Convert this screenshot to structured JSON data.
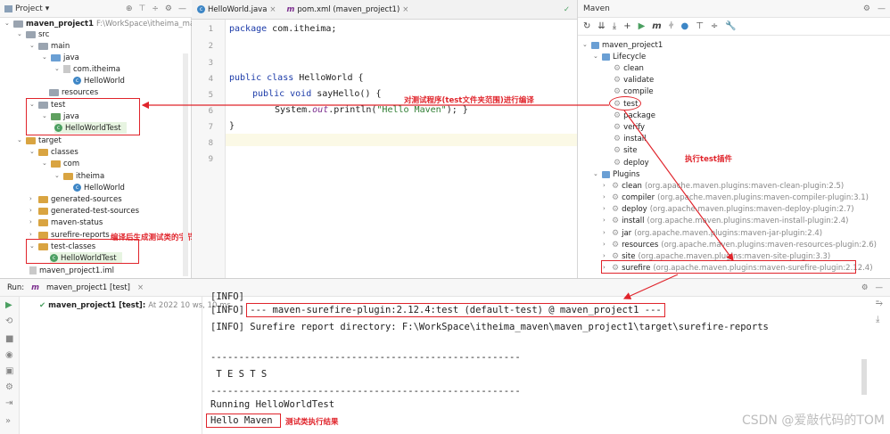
{
  "project": {
    "header_label": "Project",
    "root": {
      "name": "maven_project1",
      "path": "F:\\WorkSpace\\itheima_mave"
    },
    "items": {
      "src": "src",
      "main": "main",
      "java": "java",
      "com_itheima": "com.itheima",
      "helloworld": "HelloWorld",
      "resources": "resources",
      "test": "test",
      "test_java": "java",
      "helloworldtest": "HelloWorldTest",
      "target": "target",
      "classes": "classes",
      "com": "com",
      "itheima": "itheima",
      "helloworld_class": "HelloWorld",
      "generated_sources": "generated-sources",
      "generated_test_sources": "generated-test-sources",
      "maven_status": "maven-status",
      "surefire_reports": "surefire-reports",
      "test_classes": "test-classes",
      "helloworldtest_class": "HelloWorldTest",
      "iml": "maven_project1.iml"
    }
  },
  "editor": {
    "tabs": [
      {
        "label": "HelloWorld.java"
      },
      {
        "label": "pom.xml (maven_project1)"
      }
    ],
    "lines": [
      "1",
      "2",
      "3",
      "4",
      "5",
      "6",
      "7",
      "8",
      "9"
    ],
    "code": {
      "l1_kw": "package",
      "l1_rest": " com.itheima;",
      "l4_kw": "public class",
      "l4_rest": " HelloWorld {",
      "l5_kw": "public void",
      "l5_rest": " sayHello() {",
      "l6_pre": "System.",
      "l6_it": "out",
      "l6_mid": ".println(",
      "l6_str": "\"Hello Maven\"",
      "l6_end": "); }",
      "l7": "}"
    }
  },
  "maven": {
    "title": "Maven",
    "project": "maven_project1",
    "lifecycle_label": "Lifecycle",
    "lifecycle": [
      "clean",
      "validate",
      "compile",
      "test",
      "package",
      "verify",
      "install",
      "site",
      "deploy"
    ],
    "plugins_label": "Plugins",
    "plugins": [
      {
        "name": "clean",
        "detail": "(org.apache.maven.plugins:maven-clean-plugin:2.5)"
      },
      {
        "name": "compiler",
        "detail": "(org.apache.maven.plugins:maven-compiler-plugin:3.1)"
      },
      {
        "name": "deploy",
        "detail": "(org.apache.maven.plugins:maven-deploy-plugin:2.7)"
      },
      {
        "name": "install",
        "detail": "(org.apache.maven.plugins:maven-install-plugin:2.4)"
      },
      {
        "name": "jar",
        "detail": "(org.apache.maven.plugins:maven-jar-plugin:2.4)"
      },
      {
        "name": "resources",
        "detail": "(org.apache.maven.plugins:maven-resources-plugin:2.6)"
      },
      {
        "name": "site",
        "detail": "(org.apache.maven.plugins:maven-site-plugin:3.3)"
      },
      {
        "name": "surefire",
        "detail": "(org.apache.maven.plugins:maven-surefire-plugin:2.12.4)"
      }
    ]
  },
  "annotations": {
    "compile_test": "对测试程序(test文件夹范围)进行编译",
    "run_test_plugin": "执行test插件",
    "bytecode": "编译后生成测试类的字节码文件",
    "result": "测试类执行结果"
  },
  "run": {
    "label": "Run:",
    "tab": "maven_project1 [test]",
    "tree_item": "maven_project1 [test]:",
    "tree_time": "At 2022 10 ws, 10 ms",
    "console": {
      "l0": "[INFO]",
      "l1": "[INFO] --- maven-surefire-plugin:2.12.4:test (default-test) @ maven_project1 ---",
      "l2": "[INFO] Surefire report directory: F:\\WorkSpace\\itheima_maven\\maven_project1\\target\\surefire-reports",
      "sep1": "-------------------------------------------------------",
      "tests": " T E S T S",
      "sep2": "-------------------------------------------------------",
      "running": "Running HelloWorldTest",
      "hello": "Hello Maven"
    }
  },
  "watermark": "CSDN @爱敲代码的TOM",
  "colors": {
    "annotation": "#e0242b",
    "accent": "#3d86c6",
    "folder_test": "#5fa05f",
    "folder_target": "#d9a441"
  }
}
